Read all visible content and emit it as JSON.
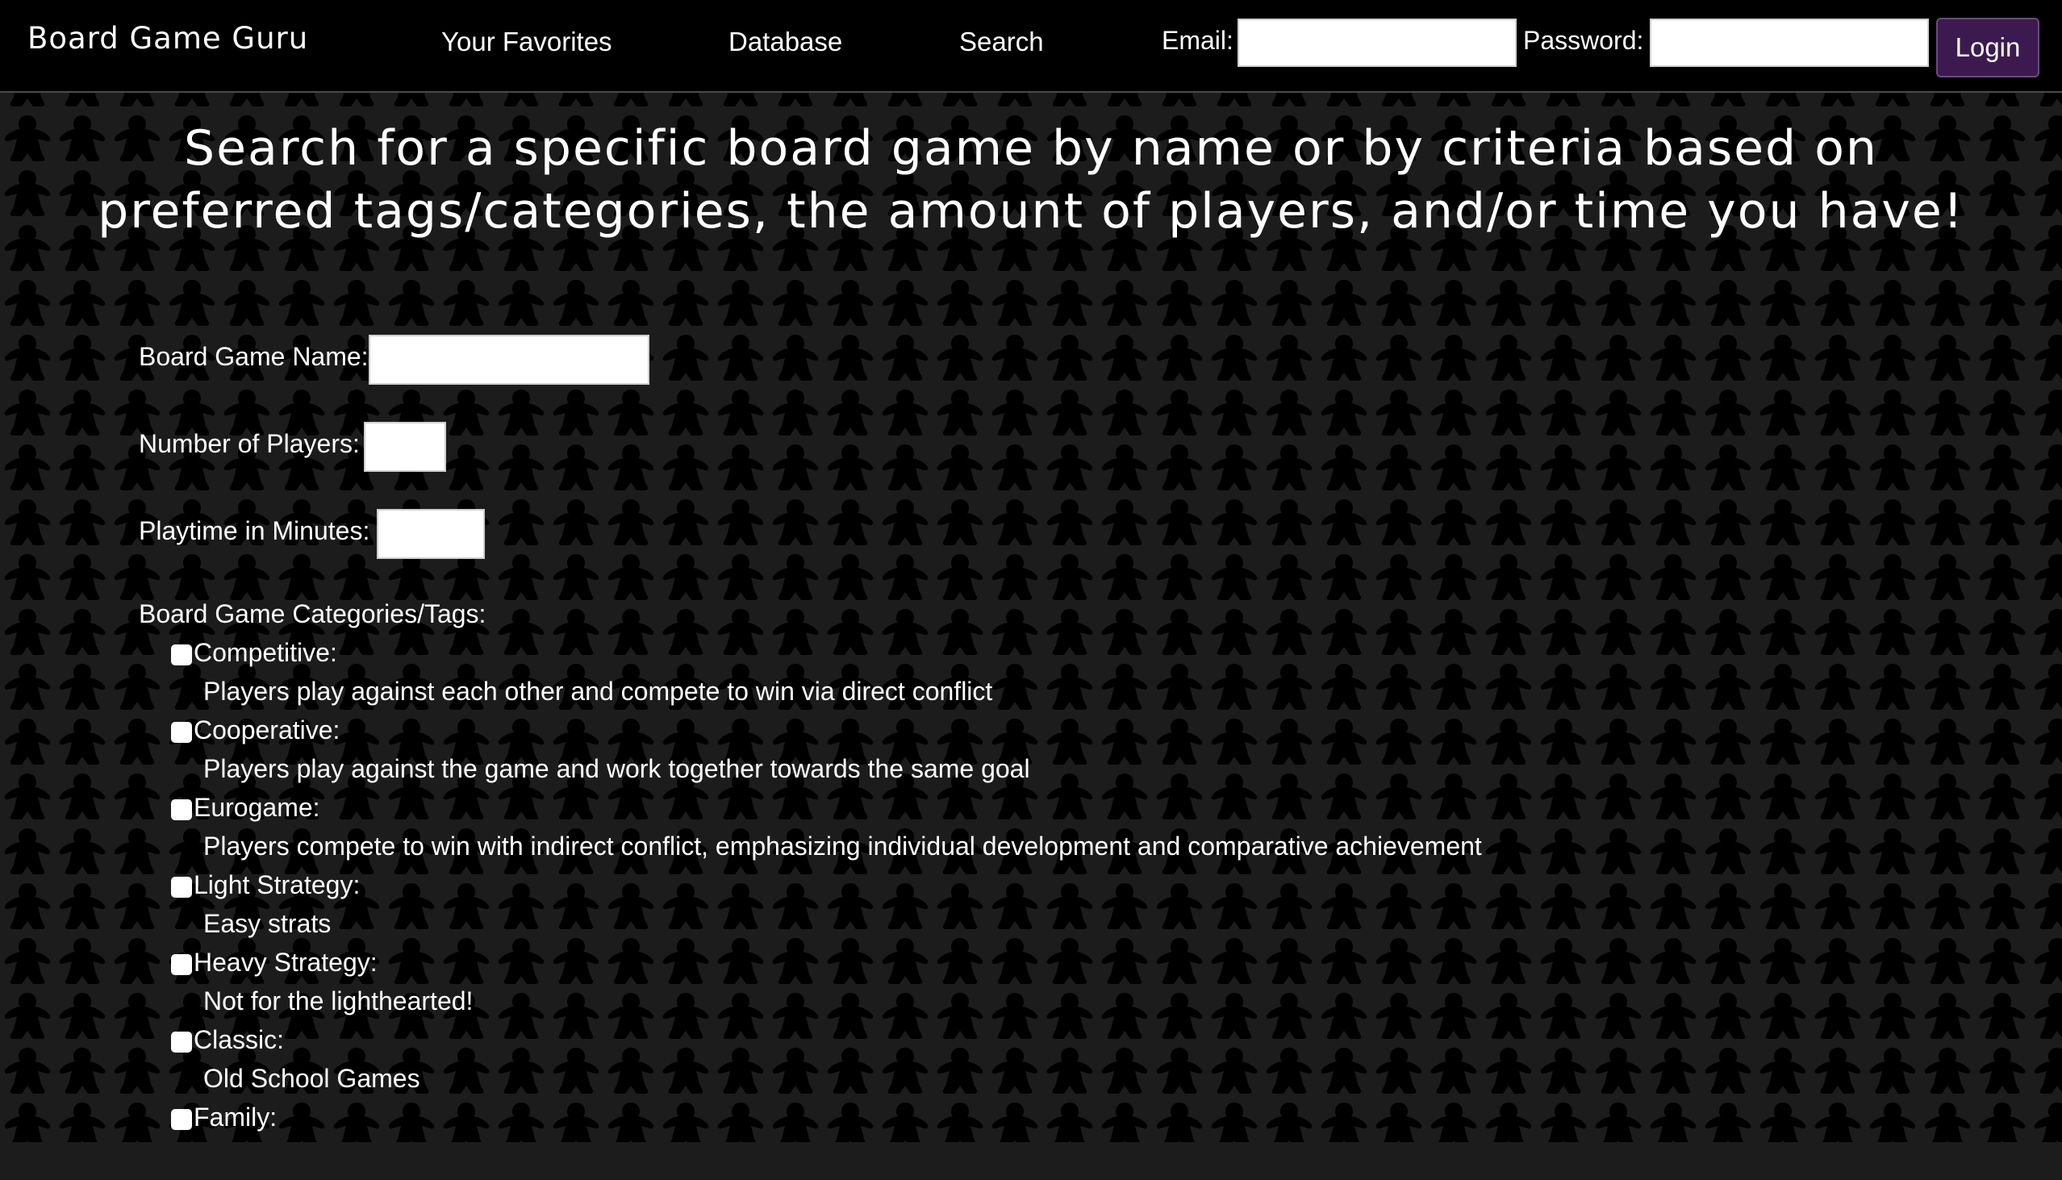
{
  "nav": {
    "brand": "Board Game Guru",
    "links": [
      {
        "label": "Your Favorites"
      },
      {
        "label": "Database"
      },
      {
        "label": "Search"
      }
    ],
    "email_label": "Email:",
    "email_value": "",
    "password_label": "Password:",
    "password_value": "",
    "login_label": "Login"
  },
  "main": {
    "heading": "Search for a specific board game by name or by criteria based on preferred tags/categories, the amount of players, and/or time you have!",
    "name_label": "Board Game Name:",
    "name_value": "",
    "players_label": "Number of Players:",
    "players_value": "",
    "playtime_label": "Playtime in Minutes:",
    "playtime_value": "",
    "categories_label": "Board Game Categories/Tags:",
    "categories": [
      {
        "name": "Competitive:",
        "description": "Players play against each other and compete to win via direct conflict",
        "checked": false
      },
      {
        "name": "Cooperative:",
        "description": "Players play against the game and work together towards the same goal",
        "checked": false
      },
      {
        "name": "Eurogame:",
        "description": "Players compete to win with indirect conflict, emphasizing individual development and comparative achievement",
        "checked": false
      },
      {
        "name": "Light Strategy:",
        "description": "Easy strats",
        "checked": false
      },
      {
        "name": "Heavy Strategy:",
        "description": "Not for the lighthearted!",
        "checked": false
      },
      {
        "name": "Classic:",
        "description": "Old School Games",
        "checked": false
      },
      {
        "name": "Family:",
        "checked": false
      }
    ]
  },
  "theme": {
    "navbar_bg": "#000000",
    "page_bg": "#1c1c1c",
    "pattern_color": "#000000",
    "login_button_bg": "#3c1a4f",
    "text_color": "#ffffff",
    "background_icon": "meeple-icon"
  }
}
